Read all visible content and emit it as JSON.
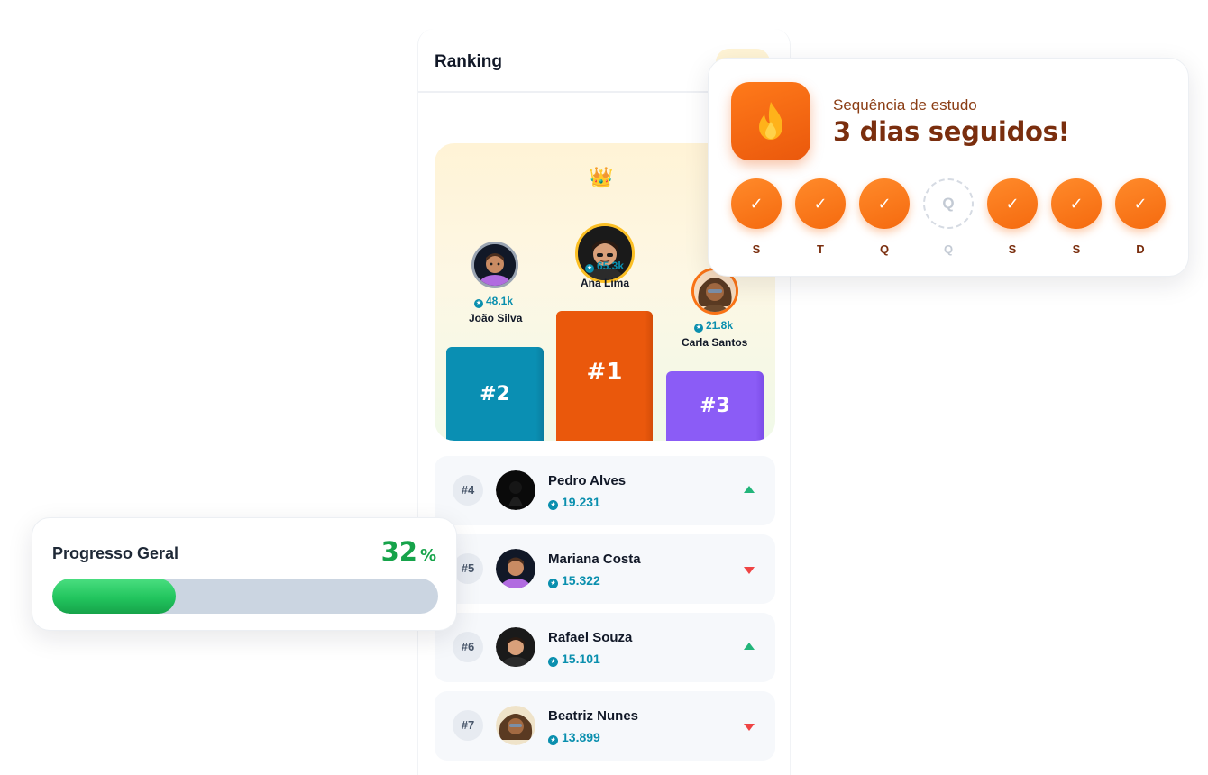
{
  "ranking": {
    "title": "Ranking",
    "podium": [
      {
        "place": 1,
        "label": "#1",
        "name": "Ana Lima",
        "points": "65.3k",
        "color": "#ea580c"
      },
      {
        "place": 2,
        "label": "#2",
        "name": "João Silva",
        "points": "48.1k",
        "color": "#0a8fb3"
      },
      {
        "place": 3,
        "label": "#3",
        "name": "Carla Santos",
        "points": "21.8k",
        "color": "#8b5cf6"
      }
    ],
    "list": [
      {
        "rank": "#4",
        "name": "Pedro Alves",
        "points": "19.231",
        "trend": "up"
      },
      {
        "rank": "#5",
        "name": "Mariana Costa",
        "points": "15.322",
        "trend": "down"
      },
      {
        "rank": "#6",
        "name": "Rafael Souza",
        "points": "15.101",
        "trend": "up"
      },
      {
        "rank": "#7",
        "name": "Beatriz Nunes",
        "points": "13.899",
        "trend": "down"
      }
    ]
  },
  "streak": {
    "subtitle": "Sequência de estudo",
    "title": "3 dias seguidos!",
    "days": [
      {
        "label": "S",
        "done": true
      },
      {
        "label": "T",
        "done": true
      },
      {
        "label": "Q",
        "done": true
      },
      {
        "label": "Q",
        "done": false
      },
      {
        "label": "S",
        "done": true
      },
      {
        "label": "S",
        "done": true
      },
      {
        "label": "D",
        "done": true
      }
    ]
  },
  "progress": {
    "title": "Progresso Geral",
    "value": "32",
    "unit": "%",
    "fraction": 0.32
  },
  "colors": {
    "accent_orange": "#f97316",
    "points_teal": "#0a8fae",
    "trend_up": "#22b57a",
    "trend_down": "#ef4444",
    "progress_green": "#22c55e"
  }
}
